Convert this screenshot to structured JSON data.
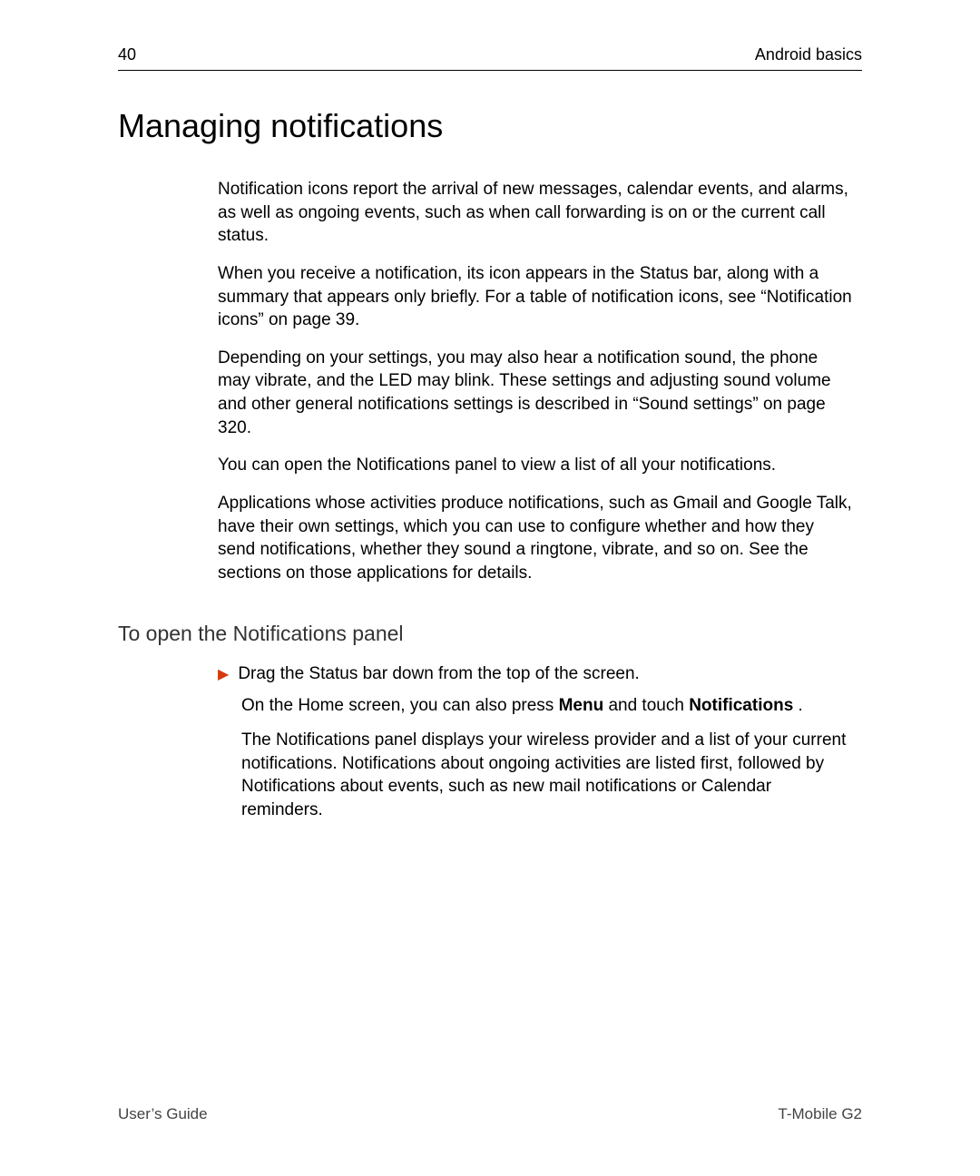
{
  "header": {
    "page_number": "40",
    "section": "Android basics"
  },
  "heading": "Managing notifications",
  "paragraphs": {
    "p1": "Notification icons report the arrival of new messages, calendar events, and alarms, as well as ongoing events, such as when call forwarding is on or the current call status.",
    "p2": "When you receive a notification, its icon appears in the Status bar, along with a summary that appears only briefly. For a table of notification icons, see “Notification icons” on page 39.",
    "p3": "Depending on your settings, you may also hear a notification sound, the phone may vibrate, and the LED may blink. These settings and adjusting sound volume and other general notifications settings is described in “Sound settings” on page 320.",
    "p4": "You can open the Notifications panel to view a list of all your notifications.",
    "p5": "Applications whose activities produce notifications, such as Gmail and Google Talk, have their own settings, which you can use to configure whether and how they send notifications, whether they sound a ringtone, vibrate, and so on. See the sections on those applications for details."
  },
  "subheading": "To open the Notifications panel",
  "bullet": {
    "main": "Drag the Status bar down from the top of the screen.",
    "sub1_pre": "On the Home screen, you can also press ",
    "sub1_bold1": "Menu",
    "sub1_mid": " and touch ",
    "sub1_bold2": "Notifications",
    "sub1_end": "   .",
    "sub2": "The Notifications panel displays your wireless provider and a list of your current notifications. Notifications about ongoing activities are listed first, followed by Notifications about events, such as new mail notifications or Calendar reminders."
  },
  "footer": {
    "left": "User’s Guide",
    "right": "T-Mobile G2"
  }
}
